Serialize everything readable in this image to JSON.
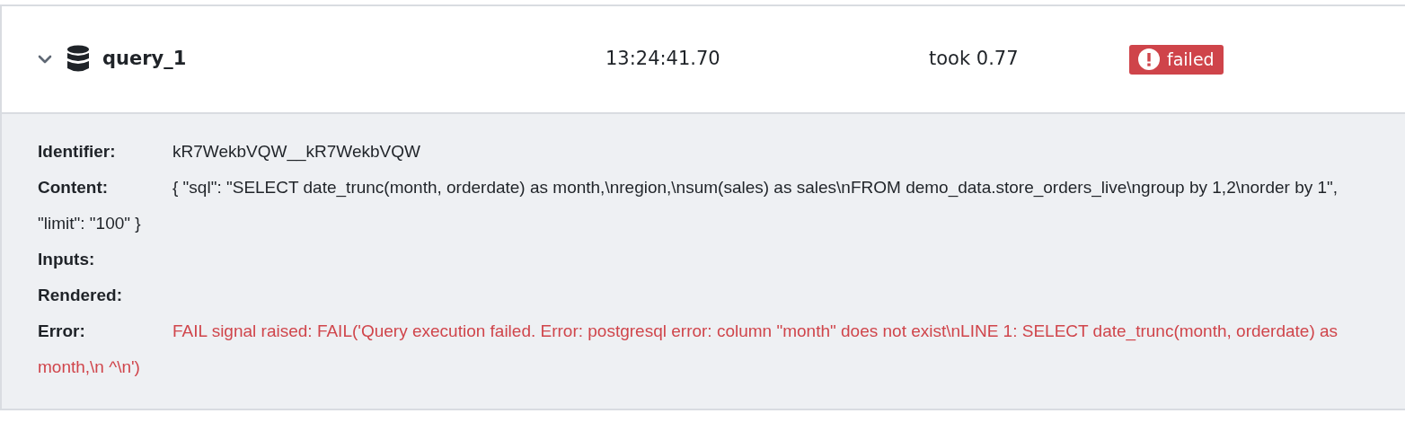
{
  "task": {
    "name": "query_1",
    "expanded": true,
    "time": "13:24:41.70",
    "duration": "took 0.77",
    "status": {
      "kind": "failed",
      "label": "failed"
    }
  },
  "details": [
    {
      "kind": "plain",
      "label": "Identifier:",
      "value": "kR7WekbVQW__kR7WekbVQW"
    },
    {
      "kind": "plain",
      "label": "Content:",
      "value": "{ \"sql\": \"SELECT date_trunc(month, orderdate) as month,\\nregion,\\nsum(sales) as sales\\nFROM demo_data.store_orders_live\\ngroup by 1,2\\norder by 1\", \"limit\": \"100\" }"
    },
    {
      "label": "Inputs:"
    },
    {
      "label": "Rendered:"
    },
    {
      "kind": "error",
      "label": "Error:",
      "value": "FAIL signal raised: FAIL('Query execution failed. Error: postgresql error: column \"month\" does not exist\\nLINE 1: SELECT date_trunc(month, orderdate) as month,\\n ^\\n')"
    }
  ]
}
